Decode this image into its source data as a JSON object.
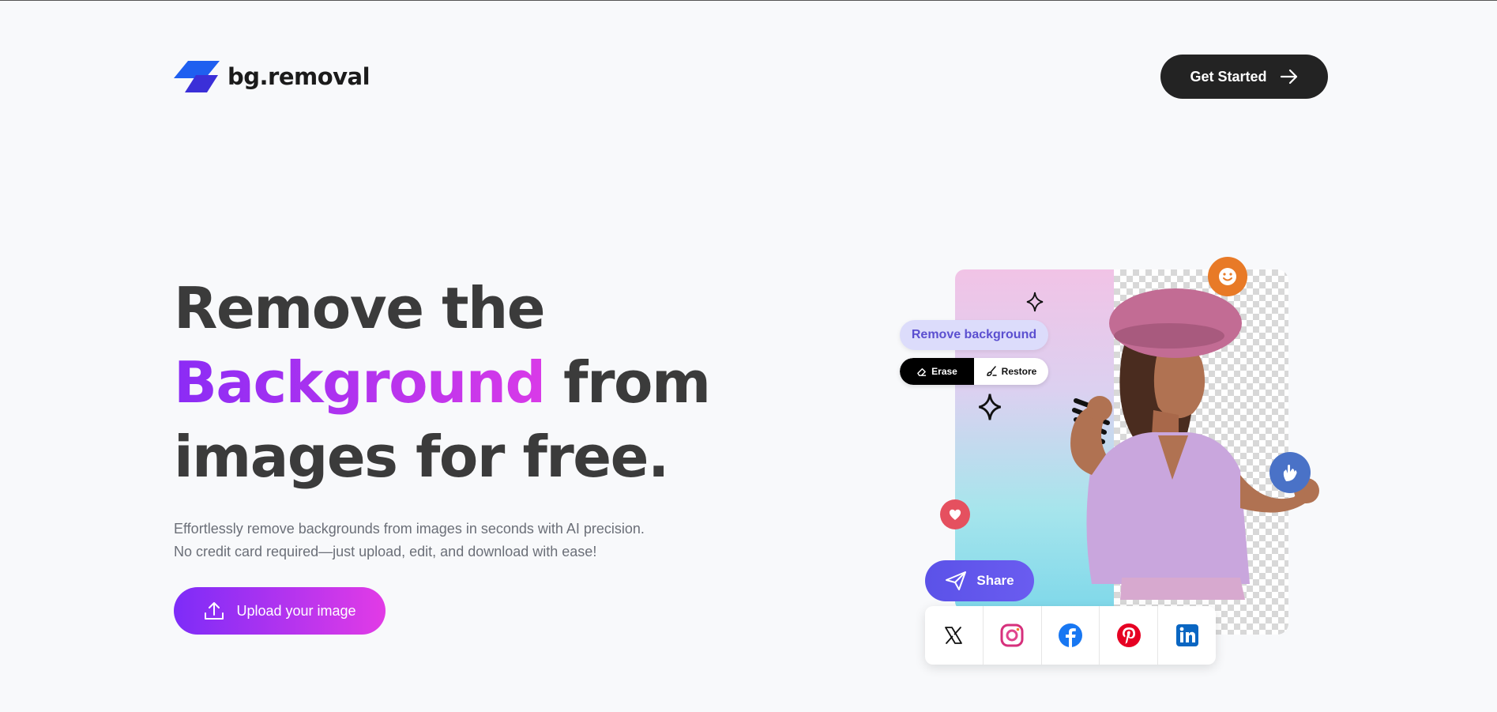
{
  "brand": {
    "name": "bg.removal",
    "logo_icon": "parallelogram-logo-icon",
    "colors": [
      "#1f5ff0",
      "#3b2fd8"
    ]
  },
  "nav": {
    "cta_label": "Get Started",
    "cta_icon": "arrow-right-icon"
  },
  "hero": {
    "headline_line1": "Remove the",
    "headline_accent": "Background",
    "headline_line2_rest": " from",
    "headline_line3": "images for free.",
    "subtitle_line1": "Effortlessly remove backgrounds from images in seconds with AI precision.",
    "subtitle_line2": "No credit card required—just upload, edit, and download with ease!",
    "upload_label": "Upload your image",
    "upload_icon": "upload-icon",
    "accent_gradient": [
      "#8b2cf5",
      "#e23be6"
    ]
  },
  "illustration": {
    "remove_bg_label": "Remove background",
    "erase_label": "Erase",
    "restore_label": "Restore",
    "share_label": "Share",
    "socials": [
      "x-icon",
      "instagram-icon",
      "facebook-icon",
      "pinterest-icon",
      "linkedin-icon"
    ],
    "reaction_icons": [
      "smile-icon",
      "hand-icon",
      "heart-icon"
    ]
  }
}
